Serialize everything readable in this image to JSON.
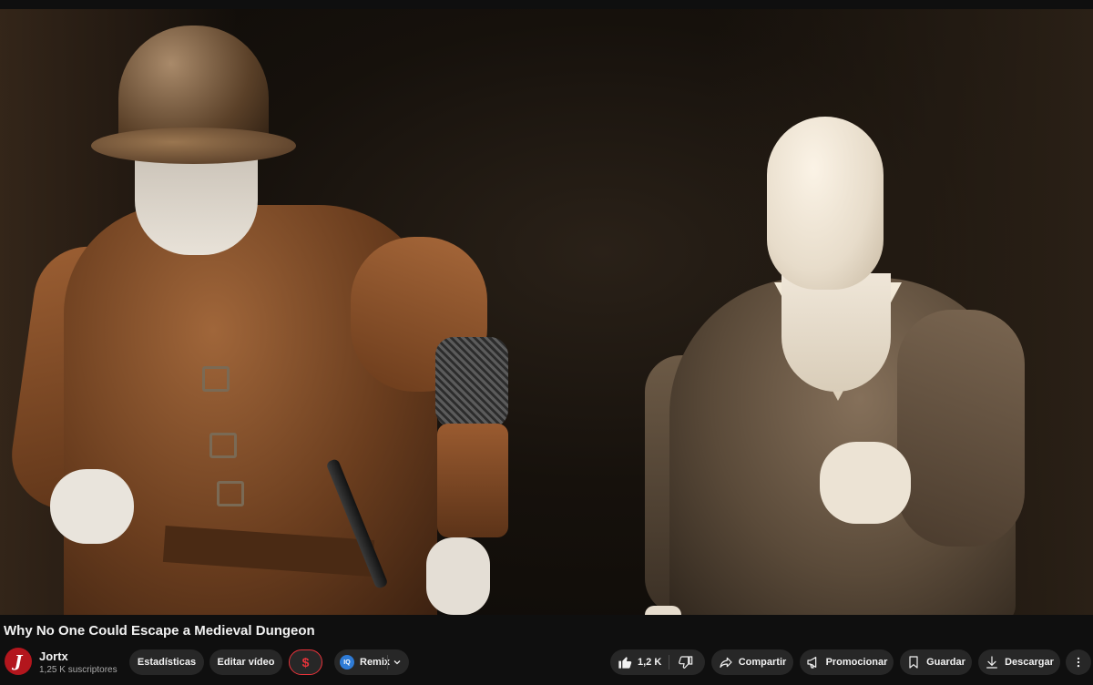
{
  "video": {
    "title": "Why No One Could Escape a Medieval Dungeon"
  },
  "channel": {
    "avatar_letter": "J",
    "name": "Jortx",
    "subscribers": "1,25 K suscriptores"
  },
  "actions": {
    "stats_label": "Estadísticas",
    "edit_label": "Editar vídeo",
    "dollar_symbol": "$",
    "remix_badge": "IQ",
    "remix_label": "Remix",
    "like_count": "1,2 K",
    "share_label": "Compartir",
    "promote_label": "Promocionar",
    "save_label": "Guardar",
    "download_label": "Descargar"
  },
  "colors": {
    "background": "#0f0f0f",
    "pill": "#272727",
    "avatar": "#b3161d",
    "dollar_accent": "#e8333a",
    "remix_badge": "#2e7bd6"
  },
  "icons": [
    "like-icon",
    "dislike-icon",
    "share-icon",
    "megaphone-icon",
    "bookmark-icon",
    "download-icon",
    "more-vertical-icon",
    "chevron-down-icon",
    "dollar-icon"
  ]
}
